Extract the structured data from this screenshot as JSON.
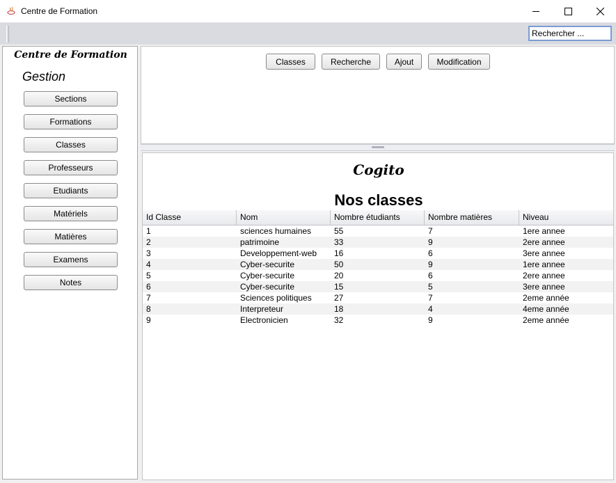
{
  "window": {
    "title": "Centre de Formation",
    "minimize_icon": "minimize-icon",
    "maximize_icon": "maximize-icon",
    "close_icon": "close-icon"
  },
  "toolbar": {
    "search_value": "Rechercher ..."
  },
  "sidebar": {
    "title": "Centre de Formation",
    "subtitle": "Gestion",
    "items": [
      {
        "label": "Sections"
      },
      {
        "label": "Formations"
      },
      {
        "label": "Classes"
      },
      {
        "label": "Professeurs"
      },
      {
        "label": "Etudiants"
      },
      {
        "label": "Matériels"
      },
      {
        "label": "Matières"
      },
      {
        "label": "Examens"
      },
      {
        "label": "Notes"
      }
    ]
  },
  "top_actions": [
    {
      "label": "Classes"
    },
    {
      "label": "Recherche"
    },
    {
      "label": "Ajout"
    },
    {
      "label": "Modification"
    }
  ],
  "main": {
    "logo": "Cogito",
    "heading": "Nos classes",
    "columns": [
      "Id Classe",
      "Nom",
      "Nombre étudiants",
      "Nombre matières",
      "Niveau"
    ],
    "rows": [
      [
        "1",
        "sciences humaines",
        "55",
        "7",
        "1ere annee"
      ],
      [
        "2",
        "patrimoine",
        "33",
        "9",
        "2ere annee"
      ],
      [
        "3",
        "Developpement-web",
        "16",
        "6",
        "3ere annee"
      ],
      [
        "4",
        "Cyber-securite",
        "50",
        "9",
        "1ere annee"
      ],
      [
        "5",
        "Cyber-securite",
        "20",
        "6",
        "2ere annee"
      ],
      [
        "6",
        "Cyber-securite",
        "15",
        "5",
        "3ere annee"
      ],
      [
        "7",
        "Sciences politiques",
        "27",
        "7",
        "2eme année"
      ],
      [
        "8",
        "Interpreteur",
        "18",
        "4",
        "4eme année"
      ],
      [
        "9",
        "Electronicien",
        "32",
        "9",
        "2eme année"
      ]
    ]
  }
}
